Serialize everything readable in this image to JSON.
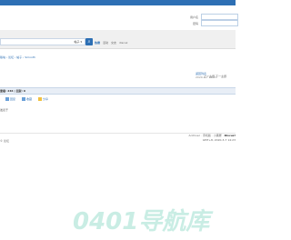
{
  "header": {
    "login": {
      "username_label": "用户名",
      "password_label": "密码"
    }
  },
  "nav": {
    "search": {
      "dropdown_label": "帖子",
      "button_icon": "search-icon"
    },
    "links": [
      "热搜",
      "活动",
      "交友",
      "discuz"
    ]
  },
  "breadcrumb": {
    "text": "版块 › 论坛 › 帖子 › Smooth"
  },
  "thread": {
    "right_link": "返回列表",
    "right_date": "2020-3-7 14:23",
    "prevnext": "上一主题 下一主题",
    "header_text": "查看: 246 | 回复: 0",
    "post_actions": [
      "回复",
      "收藏",
      "分享"
    ],
    "small_text": "发表于"
  },
  "footer": {
    "left_text": "© 论坛",
    "right_links": [
      "Archiver",
      "手机版",
      "小黑屋",
      "Discuz!"
    ],
    "right_line2": "GMT+8, 2020-3-7 14:23"
  },
  "watermark": {
    "text": "0401导航库"
  },
  "colors": {
    "primary": "#2d6fb4",
    "nav_bg": "#f0f0f0",
    "thread_head_bg": "#e8eef6",
    "watermark": "#c9ede4"
  }
}
